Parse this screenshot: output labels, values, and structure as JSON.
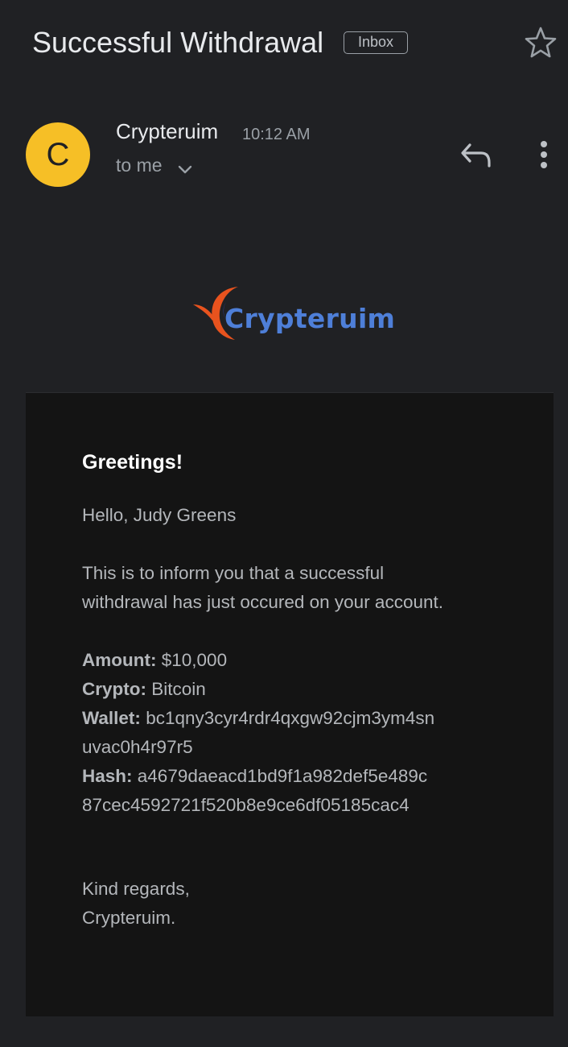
{
  "header": {
    "subject": "Successful Withdrawal",
    "badge": "Inbox",
    "star_icon": "star-outline-icon"
  },
  "sender": {
    "avatar_letter": "C",
    "avatar_color": "#f6bf26",
    "name": "Crypteruim",
    "time": "10:12 AM",
    "recipient": "to me",
    "chevron_icon": "chevron-down-icon",
    "reply_icon": "reply-icon",
    "more_icon": "more-vertical-icon"
  },
  "logo": {
    "text": "Crypteruim",
    "text_color": "#4e7fd8",
    "swoosh_color": "#e8531e"
  },
  "email_body": {
    "greeting": "Greetings!",
    "salutation": "Hello, Judy Greens",
    "intro_line1": "This is to inform you that a successful",
    "intro_line2": "withdrawal has just occured on your account.",
    "amount_label": "Amount:",
    "amount_value": "$10,000",
    "crypto_label": "Crypto:",
    "crypto_value": "Bitcoin",
    "wallet_label": "Wallet:",
    "wallet_line1": "bc1qny3cyr4rdr4qxgw92cjm3ym4sn",
    "wallet_line2": "uvac0h4r97r5",
    "hash_label": "Hash:",
    "hash_line1": "a4679daeacd1bd9f1a982def5e489c",
    "hash_line2": "87cec4592721f520b8e9ce6df05185cac4",
    "closing": "Kind regards,",
    "signature": "Crypteruim."
  }
}
